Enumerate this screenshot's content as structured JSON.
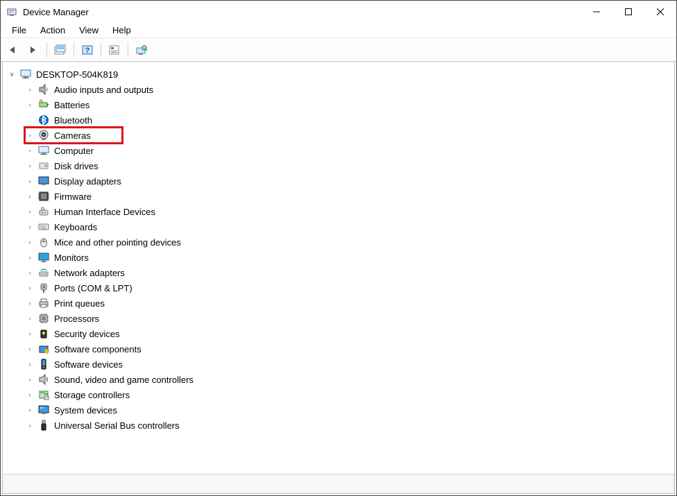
{
  "window": {
    "title": "Device Manager"
  },
  "menu": {
    "items": [
      "File",
      "Action",
      "View",
      "Help"
    ]
  },
  "toolbar": {
    "buttons": [
      "back",
      "forward",
      "show-hidden",
      "help",
      "properties",
      "scan-hardware"
    ]
  },
  "tree": {
    "root": {
      "expanded": true,
      "icon": "computer-icon",
      "label": "DESKTOP-504K819"
    },
    "categories": [
      {
        "icon": "audio-icon",
        "label": "Audio inputs and outputs",
        "highlighted": false
      },
      {
        "icon": "battery-icon",
        "label": "Batteries",
        "highlighted": false
      },
      {
        "icon": "bluetooth-icon",
        "label": "Bluetooth",
        "highlighted": false,
        "noExpander": true
      },
      {
        "icon": "camera-icon",
        "label": "Cameras",
        "highlighted": true
      },
      {
        "icon": "computer-icon",
        "label": "Computer",
        "highlighted": false
      },
      {
        "icon": "disk-icon",
        "label": "Disk drives",
        "highlighted": false
      },
      {
        "icon": "display-icon",
        "label": "Display adapters",
        "highlighted": false
      },
      {
        "icon": "firmware-icon",
        "label": "Firmware",
        "highlighted": false
      },
      {
        "icon": "hid-icon",
        "label": "Human Interface Devices",
        "highlighted": false
      },
      {
        "icon": "keyboard-icon",
        "label": "Keyboards",
        "highlighted": false
      },
      {
        "icon": "mouse-icon",
        "label": "Mice and other pointing devices",
        "highlighted": false
      },
      {
        "icon": "monitor-icon",
        "label": "Monitors",
        "highlighted": false
      },
      {
        "icon": "network-icon",
        "label": "Network adapters",
        "highlighted": false
      },
      {
        "icon": "ports-icon",
        "label": "Ports (COM & LPT)",
        "highlighted": false
      },
      {
        "icon": "printer-icon",
        "label": "Print queues",
        "highlighted": false
      },
      {
        "icon": "cpu-icon",
        "label": "Processors",
        "highlighted": false
      },
      {
        "icon": "security-icon",
        "label": "Security devices",
        "highlighted": false
      },
      {
        "icon": "component-icon",
        "label": "Software components",
        "highlighted": false
      },
      {
        "icon": "softdev-icon",
        "label": "Software devices",
        "highlighted": false
      },
      {
        "icon": "sound-icon",
        "label": "Sound, video and game controllers",
        "highlighted": false
      },
      {
        "icon": "storage-icon",
        "label": "Storage controllers",
        "highlighted": false
      },
      {
        "icon": "system-icon",
        "label": "System devices",
        "highlighted": false
      },
      {
        "icon": "usb-icon",
        "label": "Universal Serial Bus controllers",
        "highlighted": false
      }
    ]
  }
}
